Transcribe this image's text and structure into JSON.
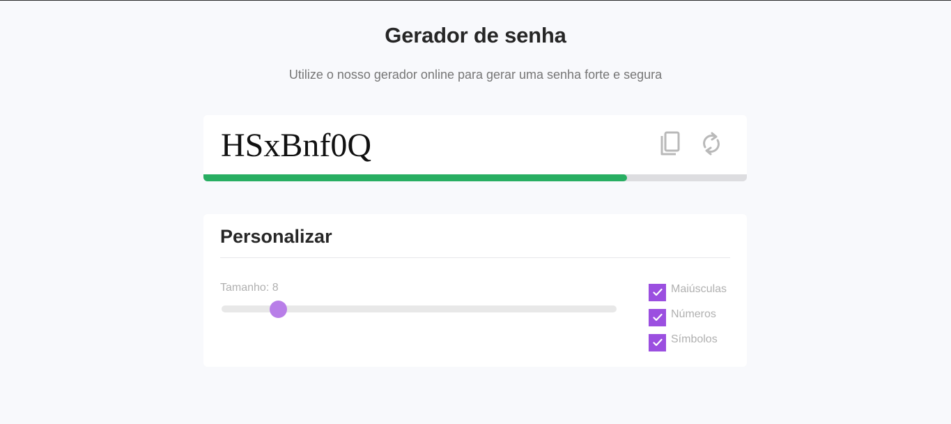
{
  "header": {
    "title": "Gerador de senha",
    "subtitle": "Utilize o nosso gerador online para gerar uma senha forte e segura"
  },
  "password": {
    "value": "HSxBnf0Q",
    "strength_fraction": 0.78,
    "copy_icon": "copy-icon",
    "refresh_icon": "refresh-icon",
    "strength_color": "#28ae62"
  },
  "customize": {
    "title": "Personalizar",
    "length_label": "Tamanho: 8",
    "length_value": 8,
    "length_min": 4,
    "length_max": 32,
    "options": [
      {
        "label": "Maiúsculas",
        "checked": true
      },
      {
        "label": "Números",
        "checked": true
      },
      {
        "label": "Símbolos",
        "checked": true
      }
    ],
    "accent_color": "#9b4fe0",
    "thumb_color": "#b87ee8"
  }
}
